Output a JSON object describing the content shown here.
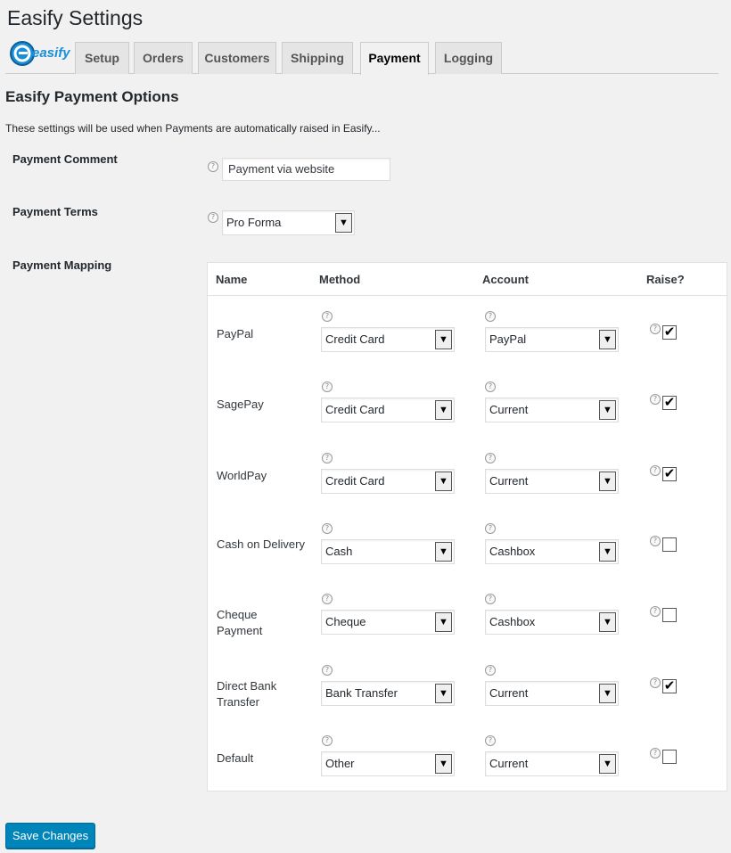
{
  "page_title": "Easify Settings",
  "logo_text": "easify",
  "tabs": [
    {
      "label": "Setup"
    },
    {
      "label": "Orders"
    },
    {
      "label": "Customers"
    },
    {
      "label": "Shipping"
    },
    {
      "label": "Payment"
    },
    {
      "label": "Logging"
    }
  ],
  "active_tab": "Payment",
  "section_title": "Easify Payment Options",
  "intro_text": "These settings will be used when Payments are automatically raised in Easify...",
  "payment_comment": {
    "label": "Payment Comment",
    "value": "Payment via website"
  },
  "payment_terms": {
    "label": "Payment Terms",
    "value": "Pro Forma"
  },
  "payment_mapping": {
    "label": "Payment Mapping",
    "headers": {
      "name": "Name",
      "method": "Method",
      "account": "Account",
      "raise": "Raise?"
    },
    "rows": [
      {
        "name": "PayPal",
        "method": "Credit Card",
        "account": "PayPal",
        "raise": true
      },
      {
        "name": "SagePay",
        "method": "Credit Card",
        "account": "Current",
        "raise": true
      },
      {
        "name": "WorldPay",
        "method": "Credit Card",
        "account": "Current",
        "raise": true
      },
      {
        "name": "Cash on Delivery",
        "method": "Cash",
        "account": "Cashbox",
        "raise": false
      },
      {
        "name": "Cheque Payment",
        "method": "Cheque",
        "account": "Cashbox",
        "raise": false
      },
      {
        "name": "Direct Bank Transfer",
        "method": "Bank Transfer",
        "account": "Current",
        "raise": true
      },
      {
        "name": "Default",
        "method": "Other",
        "account": "Current",
        "raise": false
      }
    ]
  },
  "save_button": "Save Changes",
  "help_glyph": "?",
  "select_arrow_glyph": "▼",
  "check_glyph": "✔",
  "colors": {
    "accent": "#0085ba",
    "logo_blue": "#1a8fd8",
    "background": "#f1f1f1"
  }
}
